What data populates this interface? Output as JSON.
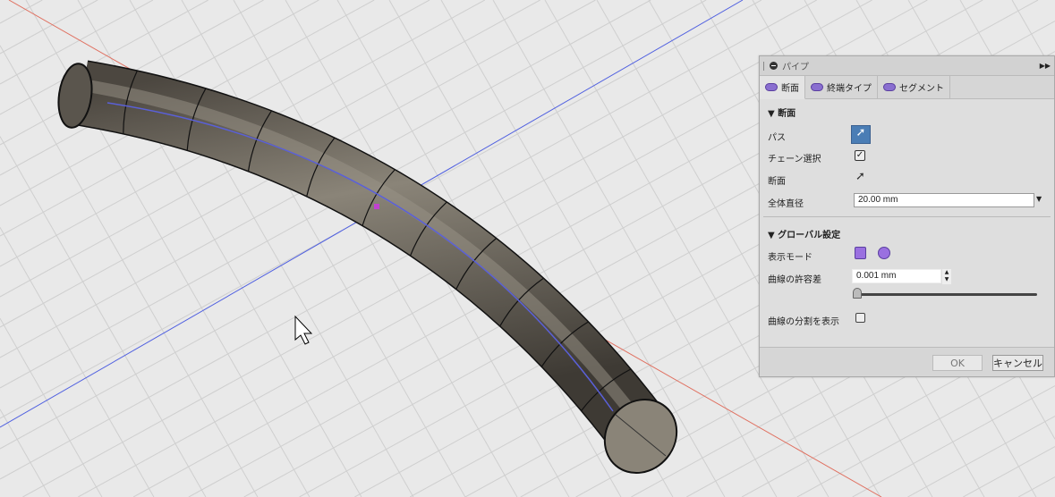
{
  "dialog": {
    "title": "パイプ",
    "tabs": [
      {
        "label": "断面"
      },
      {
        "label": "終端タイプ"
      },
      {
        "label": "セグメント"
      }
    ],
    "section1": {
      "title": "断面",
      "path_label": "パス",
      "chain_label": "チェーン選択",
      "chain_checked": true,
      "section_label": "断面",
      "diameter_label": "全体直径",
      "diameter_value": "20.00 mm"
    },
    "section2": {
      "title": "グローバル設定",
      "display_mode_label": "表示モード",
      "tolerance_label": "曲線の許容差",
      "tolerance_value": "0.001 mm",
      "tolerance_slider": 0,
      "show_divisions_label": "曲線の分割を表示",
      "show_divisions_checked": false
    },
    "ok_label": "OK",
    "cancel_label": "キャンセル"
  },
  "colors": {
    "accent": "#4a7db5",
    "x_axis": "#e05040",
    "z_axis": "#4050e0",
    "pipe": "#6b655a"
  }
}
